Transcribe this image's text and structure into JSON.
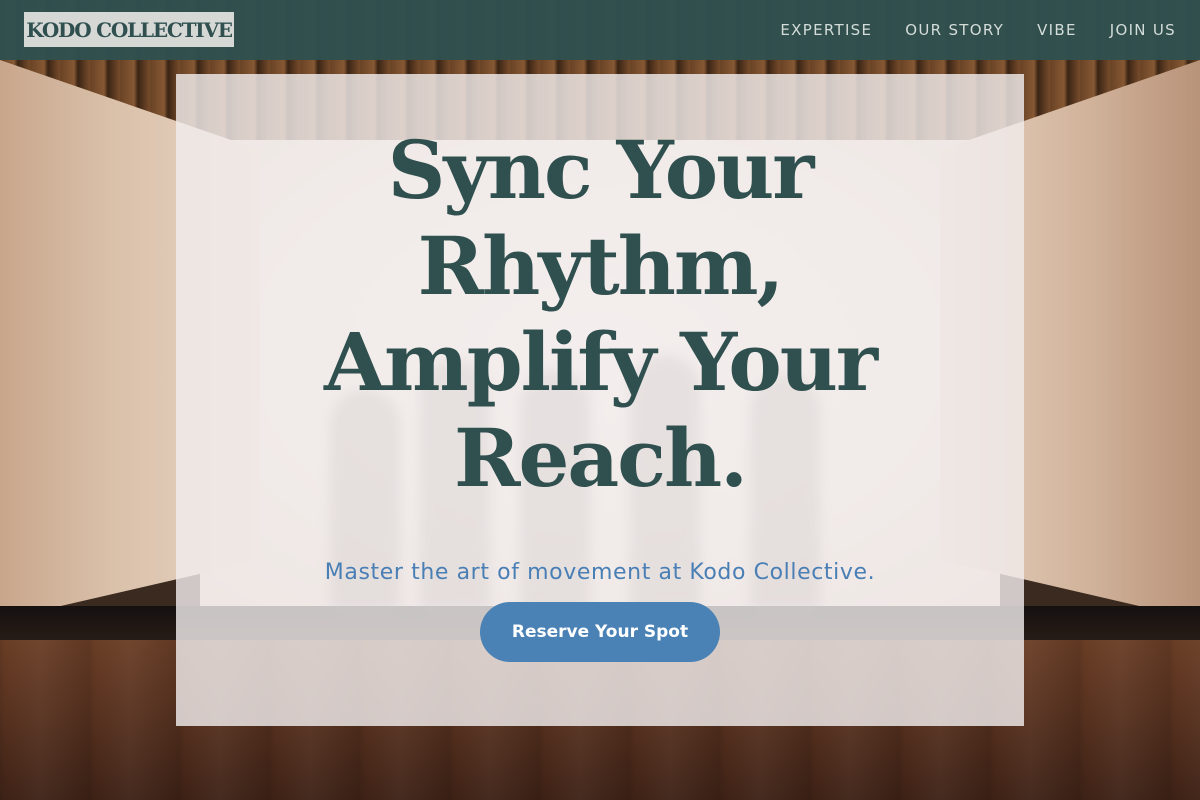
{
  "brand": {
    "logo_text": "KODO COLLECTIVE"
  },
  "nav": {
    "items": [
      {
        "label": "EXPERTISE"
      },
      {
        "label": "OUR STORY"
      },
      {
        "label": "VIBE"
      },
      {
        "label": "JOIN US"
      }
    ]
  },
  "hero": {
    "title_lines": [
      "Sync Your",
      "Rhythm,",
      "Amplify Your",
      "Reach."
    ],
    "subtitle": "Master the art of movement at Kodo Collective.",
    "cta_label": "Reserve Your Spot"
  },
  "colors": {
    "brand_dark_teal": "#2f504f",
    "accent_blue": "#4a82b5",
    "subtitle_blue": "#4a7fb5",
    "card_background": "#f0ecec"
  }
}
